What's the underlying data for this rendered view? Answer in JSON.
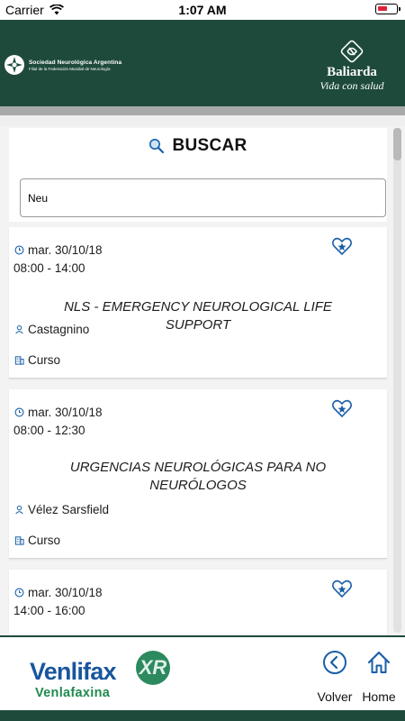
{
  "status_bar": {
    "carrier": "Carrier",
    "time": "1:07 AM"
  },
  "header": {
    "society_name": "Sociedad Neurológica Argentina",
    "society_subtitle": "Filial de la Federación Mundial de Neurología",
    "sponsor_name": "Baliarda",
    "sponsor_slogan": "Vida con salud"
  },
  "search": {
    "title": "BUSCAR",
    "value": "Neu"
  },
  "events": [
    {
      "date": "mar. 30/10/18",
      "time": "08:00 - 14:00",
      "title": "NLS - EMERGENCY NEUROLOGICAL LIFE SUPPORT",
      "speaker": "Castagnino",
      "type": "Curso"
    },
    {
      "date": "mar. 30/10/18",
      "time": "08:00 - 12:30",
      "title": "URGENCIAS NEUROLÓGICAS PARA NO NEURÓLOGOS",
      "speaker": "Vélez Sarsfield",
      "type": "Curso"
    },
    {
      "date": "mar. 30/10/18",
      "time": "14:00 - 16:00"
    }
  ],
  "footer": {
    "brand": "Venlifax",
    "brand_badge": "XR",
    "generic": "Venlafaxina",
    "back_label": "Volver",
    "home_label": "Home"
  },
  "colors": {
    "header_bg": "#1e4a3c",
    "brand_blue": "#18569e",
    "brand_green": "#1f8a4f",
    "icon_blue": "#1a5fa8"
  }
}
